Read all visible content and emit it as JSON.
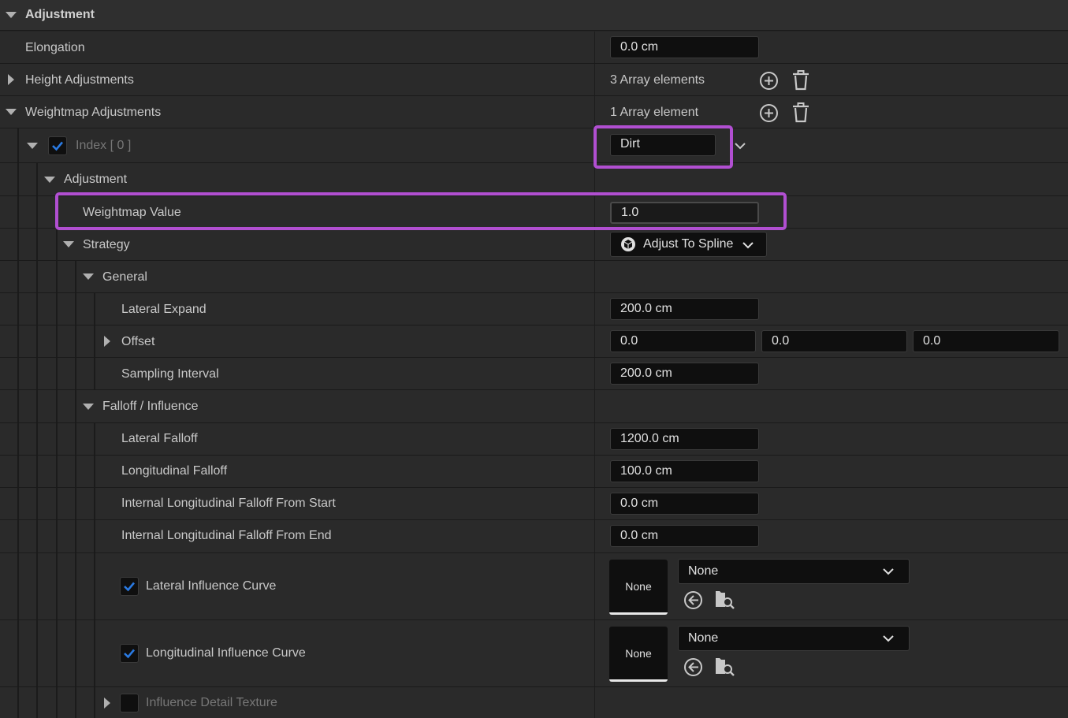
{
  "rows": {
    "adjustment_header": "Adjustment",
    "elongation": {
      "label": "Elongation",
      "value": "0.0 cm"
    },
    "height_adjustments": {
      "label": "Height Adjustments",
      "count": "3 Array elements"
    },
    "weightmap_adjustments": {
      "label": "Weightmap Adjustments",
      "count": "1 Array element"
    },
    "index0": {
      "label": "Index [ 0 ]",
      "value": "Dirt"
    },
    "inner_adjustment": "Adjustment",
    "weightmap_value": {
      "label": "Weightmap Value",
      "value": "1.0"
    },
    "strategy": {
      "label": "Strategy",
      "value": "Adjust To Spline"
    },
    "general": "General",
    "lateral_expand": {
      "label": "Lateral Expand",
      "value": "200.0 cm"
    },
    "offset": {
      "label": "Offset",
      "x": "0.0",
      "y": "0.0",
      "z": "0.0"
    },
    "sampling_interval": {
      "label": "Sampling Interval",
      "value": "200.0 cm"
    },
    "falloff_influence": "Falloff / Influence",
    "lateral_falloff": {
      "label": "Lateral Falloff",
      "value": "1200.0 cm"
    },
    "longitudinal_falloff": {
      "label": "Longitudinal Falloff",
      "value": "100.0 cm"
    },
    "internal_from_start": {
      "label": "Internal Longitudinal Falloff From Start",
      "value": "0.0 cm"
    },
    "internal_from_end": {
      "label": "Internal Longitudinal Falloff From End",
      "value": "0.0 cm"
    },
    "lateral_influence_curve": {
      "label": "Lateral Influence Curve",
      "thumb": "None",
      "value": "None"
    },
    "longitudinal_influence_curve": {
      "label": "Longitudinal Influence Curve",
      "thumb": "None",
      "value": "None"
    },
    "influence_detail_texture": {
      "label": "Influence Detail Texture"
    }
  },
  "colors": {
    "highlight": "#b14fd1",
    "check_accent": "#2a7ae2",
    "background": "#242424"
  },
  "icons": {
    "add": "plus-circle-icon",
    "delete": "trash-icon",
    "reset": "arrow-left-circle-icon",
    "browse": "folder-search-icon",
    "strategy": "cube-icon"
  }
}
